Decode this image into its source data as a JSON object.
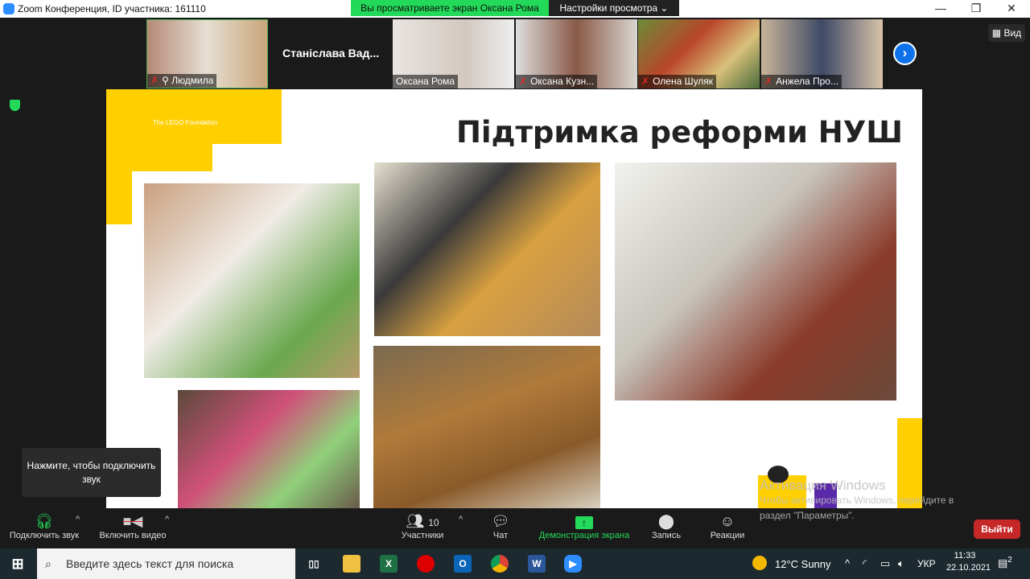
{
  "window": {
    "title": "Zoom Конференция, ID участника: 161110",
    "banner": "Вы просматриваете экран Оксана Рома",
    "view_settings": "Настройки просмотра ⌄",
    "minimize": "—",
    "maximize": "❐",
    "close": "✕"
  },
  "participants": [
    {
      "name": "Людмила",
      "muted": true,
      "pinned": true
    },
    {
      "name": "Станіслава Вад...",
      "video": false
    },
    {
      "name": "Оксана Рома",
      "muted": false
    },
    {
      "name": "Оксана Кузн...",
      "muted": true
    },
    {
      "name": "Олена Шуляк",
      "muted": true
    },
    {
      "name": "Анжела Про...",
      "muted": true
    }
  ],
  "view_button": "Вид",
  "slide": {
    "logo": "The LEGO Foundation",
    "title": "Підтримка реформи НУШ"
  },
  "tooltip": "Нажмите, чтобы подключить звук",
  "toolbar": {
    "audio": "Подключить звук",
    "video": "Включить видео",
    "participants": "Участники",
    "participants_count": "10",
    "chat": "Чат",
    "share": "Демонстрация экрана",
    "record": "Запись",
    "reactions": "Реакции",
    "exit": "Выйти"
  },
  "watermark": {
    "title": "Активация Windows",
    "line1": "Чтобы активировать Windows, перейдите в",
    "line2": "раздел \"Параметры\"."
  },
  "taskbar": {
    "search_placeholder": "Введите здесь текст для поиска",
    "weather": "12°C  Sunny",
    "lang": "УКР",
    "time": "11:33",
    "date": "22.10.2021",
    "notifications": "2"
  }
}
